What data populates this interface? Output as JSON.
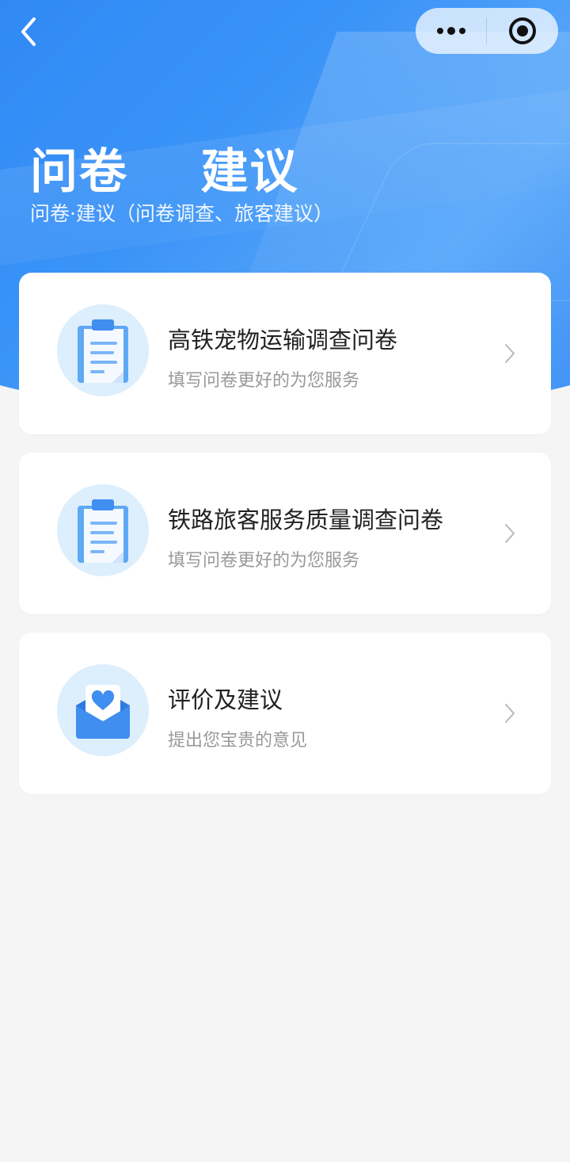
{
  "header": {
    "title": "问卷    建议",
    "subtitle": "问卷·建议（问卷调查、旅客建议）",
    "back_icon": "chevron-left-icon",
    "capsule": {
      "more_icon": "more-dots-icon",
      "close_icon": "target-close-icon"
    }
  },
  "cards": [
    {
      "title": "高铁宠物运输调查问卷",
      "desc": "填写问卷更好的为您服务",
      "icon": "clipboard-icon"
    },
    {
      "title": "铁路旅客服务质量调查问卷",
      "desc": "填写问卷更好的为您服务",
      "icon": "clipboard-icon"
    },
    {
      "title": "评价及建议",
      "desc": "提出您宝贵的意见",
      "icon": "heart-envelope-icon"
    }
  ],
  "colors": {
    "brand_blue": "#2f86f4",
    "icon_bg": "#ddeefc",
    "page_bg": "#f5f5f5"
  }
}
